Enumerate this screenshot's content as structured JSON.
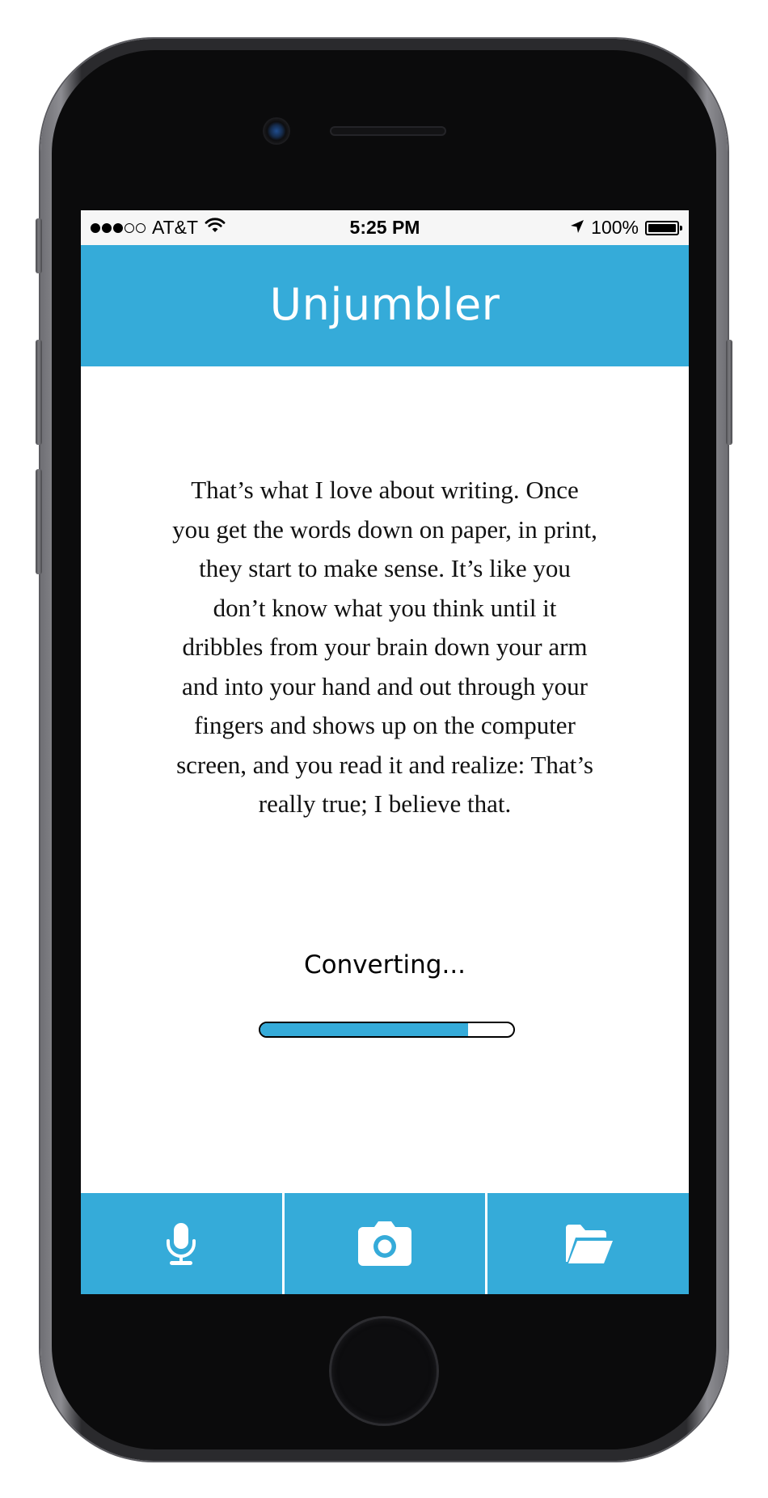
{
  "theme": {
    "accent": "#35abd9"
  },
  "status_bar": {
    "carrier": "AT&T",
    "signal_bars_filled": 3,
    "signal_bars_total": 5,
    "time": "5:25 PM",
    "battery": "100%",
    "icons": [
      "wifi-icon",
      "location-arrow-icon",
      "battery-icon"
    ]
  },
  "header": {
    "title": "Unjumbler"
  },
  "content": {
    "quote": "That’s what I love about writing. Once you get the words down on paper, in print, they start to make sense. It’s like you don’t know what you think until it dribbles from your brain down your arm and into your hand and out through your fingers and shows up on the computer screen, and you read it and realize: That’s really true; I believe that.",
    "status_label": "Converting...",
    "progress": 0.82
  },
  "tab_bar": {
    "tabs": [
      {
        "icon": "microphone-icon"
      },
      {
        "icon": "camera-icon"
      },
      {
        "icon": "folder-icon"
      }
    ]
  }
}
